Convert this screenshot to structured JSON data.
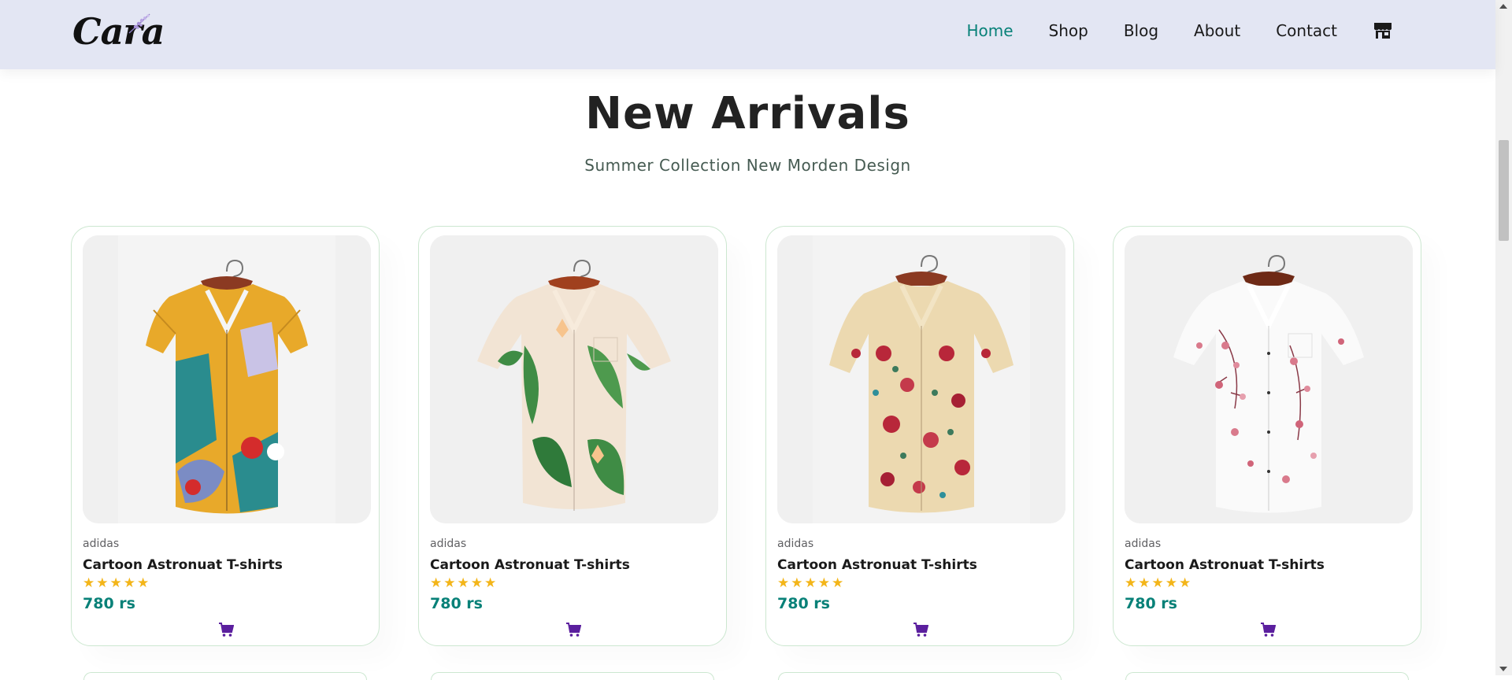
{
  "brand": {
    "logo_text": "Cara"
  },
  "nav": {
    "items": [
      {
        "label": "Home",
        "active": true
      },
      {
        "label": "Shop",
        "active": false
      },
      {
        "label": "Blog",
        "active": false
      },
      {
        "label": "About",
        "active": false
      },
      {
        "label": "Contact",
        "active": false
      }
    ],
    "cart_icon": "store-icon"
  },
  "section": {
    "title": "New Arrivals",
    "subtitle": "Summer Collection New Morden Design"
  },
  "products": [
    {
      "brand": "adidas",
      "name": "Cartoon Astronuat T-shirts",
      "rating": 5,
      "price": "780 rs",
      "pattern": "abstract-multicolor"
    },
    {
      "brand": "adidas",
      "name": "Cartoon Astronuat T-shirts",
      "rating": 5,
      "price": "780 rs",
      "pattern": "tropical-leaves"
    },
    {
      "brand": "adidas",
      "name": "Cartoon Astronuat T-shirts",
      "rating": 5,
      "price": "780 rs",
      "pattern": "beige-floral"
    },
    {
      "brand": "adidas",
      "name": "Cartoon Astronuat T-shirts",
      "rating": 5,
      "price": "780 rs",
      "pattern": "white-cherry-blossom"
    }
  ],
  "colors": {
    "accent": "#088178",
    "header_bg": "#e3e6f3",
    "star": "#f3b519",
    "cart_icon": "#5b1f9e"
  }
}
